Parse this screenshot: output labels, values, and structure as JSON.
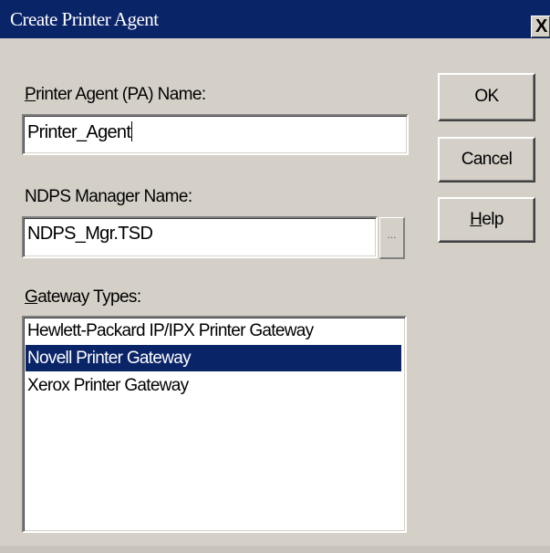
{
  "window": {
    "title": "Create Printer Agent",
    "close_glyph": "X"
  },
  "pa_name": {
    "label_mnemonic": "P",
    "label_rest": "rinter Agent (PA) Name:",
    "value": "Printer_Agent"
  },
  "manager": {
    "label": "NDPS Manager Name:",
    "value": "NDPS_Mgr.TSD",
    "browse_glyph": "..."
  },
  "gateway": {
    "label_mnemonic": "G",
    "label_rest": "ateway Types:",
    "items": [
      {
        "label": "Hewlett-Packard IP/IPX Printer Gateway",
        "selected": false
      },
      {
        "label": "Novell Printer Gateway",
        "selected": true
      },
      {
        "label": "Xerox Printer Gateway",
        "selected": false
      }
    ]
  },
  "buttons": {
    "ok": "OK",
    "cancel": "Cancel",
    "help_mnemonic": "H",
    "help_rest": "elp"
  },
  "colors": {
    "titlebar": "#0a2468",
    "face": "#d4d0c8",
    "selection": "#0a2468"
  }
}
